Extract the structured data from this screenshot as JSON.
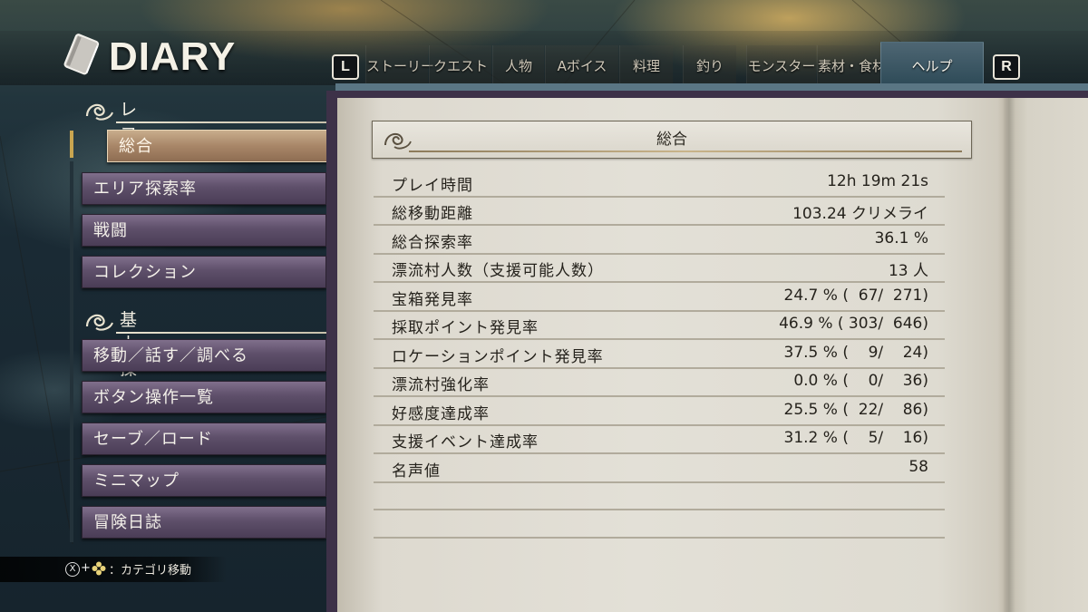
{
  "header": {
    "title": "DIARY",
    "left_shoulder": "L",
    "right_shoulder": "R",
    "tabs": [
      {
        "label": "ストーリー"
      },
      {
        "label": "クエスト"
      },
      {
        "label": "人物"
      },
      {
        "label": "Aボイス"
      },
      {
        "label": "料理"
      },
      {
        "label": "釣り"
      },
      {
        "label": "モンスター"
      },
      {
        "label": "素材・食材"
      },
      {
        "label": "ヘルプ",
        "active": true
      }
    ]
  },
  "sidebar": {
    "sections": [
      {
        "title": "レコード",
        "items": [
          "総合",
          "エリア探索率",
          "戦闘",
          "コレクション"
        ],
        "selected": "総合"
      },
      {
        "title": "基本操作",
        "items": [
          "移動／話す／調べる",
          "ボタン操作一覧",
          "セーブ／ロード",
          "ミニマップ",
          "冒険日誌"
        ]
      }
    ]
  },
  "hint": {
    "button": "X",
    "plus": "+",
    "text": "：カテゴリ移動"
  },
  "content": {
    "title": "総合",
    "rows": [
      {
        "label": "プレイ時間",
        "value": "12h 19m 21s"
      },
      {
        "label": "総移動距離",
        "value": "103.24 クリメライ"
      },
      {
        "label": "総合探索率",
        "value": "36.1 %"
      },
      {
        "label": "漂流村人数（支援可能人数）",
        "value": "13 人"
      },
      {
        "label": "宝箱発見率",
        "value": "24.7 % (  67/  271)"
      },
      {
        "label": "採取ポイント発見率",
        "value": "46.9 % ( 303/  646)"
      },
      {
        "label": "ロケーションポイント発見率",
        "value": "37.5 % (    9/    24)"
      },
      {
        "label": "漂流村強化率",
        "value": "0.0 % (    0/    36)"
      },
      {
        "label": "好感度達成率",
        "value": "25.5 % (  22/    86)"
      },
      {
        "label": "支援イベント達成率",
        "value": "31.2 % (    5/    16)"
      },
      {
        "label": "名声値",
        "value": "58"
      }
    ]
  },
  "colors": {
    "menu_button": "#5e4f6a",
    "menu_selected": "#a88668",
    "active_tab": "#3d5a68",
    "page": "#e3e0d7"
  }
}
